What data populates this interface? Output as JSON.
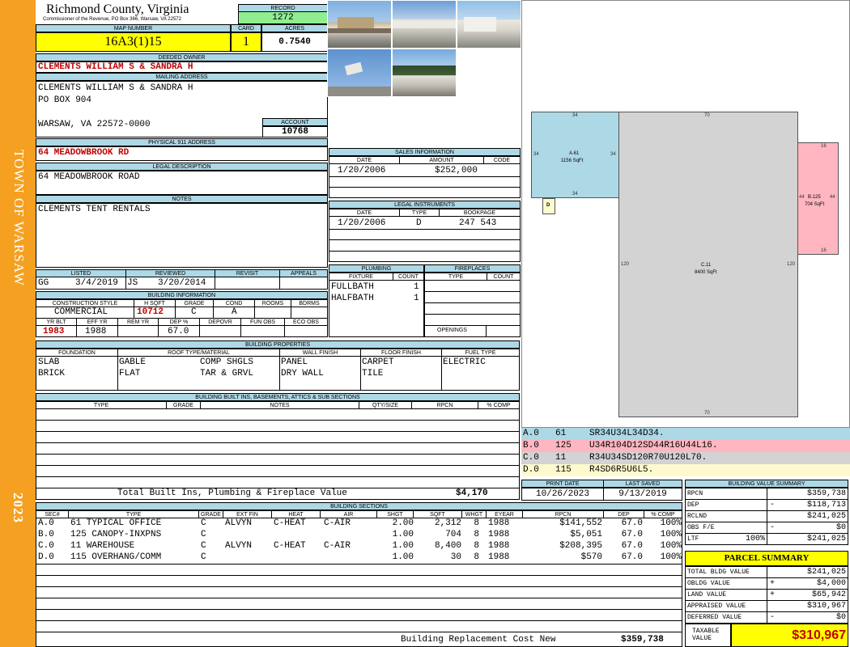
{
  "sidebar": {
    "town": "TOWN OF WARSAW",
    "year": "2023"
  },
  "header": {
    "county": "Richmond County, Virginia",
    "commissioner": "Commissioner of the Revenue, PO Box 366, Warsaw, VA 22572",
    "record_label": "RECORD",
    "record": "1272"
  },
  "parcel": {
    "map_label": "MAP NUMBER",
    "map_number": "16A3(1)15",
    "card_label": "CARD",
    "card": "1",
    "acres_label": "ACRES",
    "acres": "0.7540"
  },
  "owner": {
    "label": "DEEDED OWNER",
    "name": "CLEMENTS WILLIAM S & SANDRA H"
  },
  "mailing": {
    "label": "MAILING ADDRESS",
    "line1": "CLEMENTS WILLIAM S & SANDRA H",
    "line2": "PO BOX 904",
    "line3": "WARSAW, VA 22572-0000"
  },
  "account": {
    "label": "ACCOUNT",
    "value": "10768"
  },
  "physical": {
    "label": "PHYSICAL 911 ADDRESS",
    "value": "64 MEADOWBROOK RD"
  },
  "legal": {
    "label": "LEGAL DESCRIPTION",
    "value": "64 MEADOWBROOK ROAD"
  },
  "notes": {
    "label": "NOTES",
    "value": "CLEMENTS TENT RENTALS"
  },
  "sales": {
    "label": "SALES INFORMATION",
    "h_date": "DATE",
    "h_amount": "AMOUNT",
    "h_code": "CODE",
    "date": "1/20/2006",
    "amount": "$252,000"
  },
  "legal_inst": {
    "label": "LEGAL INSTRUMENTS",
    "h_date": "DATE",
    "h_type": "TYPE",
    "h_book": "BOOKPAGE",
    "date": "1/20/2006",
    "type": "D",
    "book": "247 543"
  },
  "plumbing": {
    "label": "PLUMBING",
    "h_fixture": "FIXTURE",
    "h_count": "COUNT",
    "rows": [
      {
        "fixture": "FULLBATH",
        "count": "1"
      },
      {
        "fixture": "HALFBATH",
        "count": "1"
      }
    ]
  },
  "fireplaces": {
    "label": "FIREPLACES",
    "h_type": "TYPE",
    "h_count": "COUNT",
    "openings": "OPENINGS"
  },
  "listing": {
    "h_listed": "LISTED",
    "h_reviewed": "REVIEWED",
    "h_revisit": "REVISIT",
    "h_appeals": "APPEALS",
    "listed_by": "GG",
    "listed_date": "3/4/2019",
    "reviewed_by": "JS",
    "reviewed_date": "3/20/2014"
  },
  "bldg_info": {
    "label": "BUILDING INFORMATION",
    "h_style": "CONSTRUCTION STYLE",
    "h_hsqft": "H SQFT",
    "h_grade": "GRADE",
    "h_cond": "COND",
    "h_rooms": "ROOMS",
    "h_bdrms": "BDRMS",
    "style": "COMMERCIAL",
    "hsqft": "10712",
    "grade": "C",
    "cond": "A",
    "h_yrblt": "YR BLT",
    "h_effyr": "EFF YR",
    "h_remyr": "REM YR",
    "h_dep": "DEP %",
    "h_depovr": "DEPOVR",
    "h_funobs": "FUN OBS",
    "h_ecoobs": "ECO OBS",
    "yrblt": "1983",
    "effyr": "1988",
    "dep": "67.0"
  },
  "props": {
    "label": "BUILDING PROPERTIES",
    "h_found": "FOUNDATION",
    "h_roof": "ROOF TYPE/MATERIAL",
    "h_wall": "WALL FINISH",
    "h_floor": "FLOOR FINISH",
    "h_fuel": "FUEL TYPE",
    "found1": "SLAB",
    "found2": "BRICK",
    "roof1a": "GABLE",
    "roof1b": "COMP SHGLS",
    "roof2a": "FLAT",
    "roof2b": "TAR & GRVL",
    "wall1": "PANEL",
    "wall2": "DRY WALL",
    "floor1": "CARPET",
    "floor2": "TILE",
    "fuel1": "ELECTRIC"
  },
  "builtins": {
    "label": "BUILDING BUILT INS, BASEMENTS, ATTICS & SUB SECTIONS",
    "h_type": "TYPE",
    "h_grade": "GRADE",
    "h_notes": "NOTES",
    "h_qty": "QTY/SIZE",
    "h_rpcn": "RPCN",
    "h_pct": "% COMP",
    "total_label": "Total Built Ins, Plumbing & Fireplace Value",
    "total": "$4,170"
  },
  "sketch_legend": [
    {
      "code": "A.0",
      "num": "61",
      "path": "SR34U34L34D34.",
      "color": "#add8e6"
    },
    {
      "code": "B.0",
      "num": "125",
      "path": "U34R104D12SD44R16U44L16.",
      "color": "#ffb6c1"
    },
    {
      "code": "C.0",
      "num": "11",
      "path": "R34U34SD120R70U120L70.",
      "color": "#d3d3d3"
    },
    {
      "code": "D.0",
      "num": "115",
      "path": "R4SD6R5U6L5.",
      "color": "#fffacd"
    }
  ],
  "sketch": {
    "a_label": "A.61",
    "a_area": "1156 SqFt",
    "a_top": "34",
    "a_left": "34",
    "a_right": "34",
    "a_bottom": "34",
    "b_label": "B.125",
    "b_area": "704 SqFt",
    "b_top": "16",
    "b_left": "44",
    "b_right": "44",
    "b_bottom": "16",
    "c_label": "C.11",
    "c_area": "8400 SqFt",
    "c_top": "70",
    "c_left": "120",
    "c_right": "120",
    "c_bottom": "70",
    "d_label": "D"
  },
  "dates": {
    "h_print": "PRINT DATE",
    "h_saved": "LAST SAVED",
    "print": "10/26/2023",
    "saved": "9/13/2019"
  },
  "sections": {
    "label": "BUILDING SECTIONS",
    "headers": [
      "SEC#",
      "TYPE",
      "GRADE",
      "EXT FIN",
      "HEAT",
      "AIR",
      "SHGT",
      "SQFT",
      "WHGT",
      "EYEAR",
      "RPCN",
      "DEP",
      "% COMP"
    ],
    "rows": [
      [
        "A.0",
        "61 TYPICAL OFFICE",
        "C",
        "ALVYN",
        "C-HEAT",
        "C-AIR",
        "2.00",
        "2,312",
        "8",
        "1988",
        "$141,552",
        "67.0",
        "100%"
      ],
      [
        "B.0",
        "125 CANOPY-INXPNS",
        "C",
        "",
        "",
        "",
        "1.00",
        "704",
        "8",
        "1988",
        "$5,051",
        "67.0",
        "100%"
      ],
      [
        "C.0",
        "11 WAREHOUSE",
        "C",
        "ALVYN",
        "C-HEAT",
        "C-AIR",
        "1.00",
        "8,400",
        "8",
        "1988",
        "$208,395",
        "67.0",
        "100%"
      ],
      [
        "D.0",
        "115 OVERHANG/COMM",
        "C",
        "",
        "",
        "",
        "1.00",
        "30",
        "8",
        "1988",
        "$570",
        "67.0",
        "100%"
      ]
    ],
    "replacement_label": "Building Replacement Cost New",
    "replacement": "$359,738"
  },
  "summary": {
    "label": "BUILDING VALUE SUMMARY",
    "rows": [
      {
        "k": "RPCN",
        "op": "",
        "pct": "",
        "v": "$359,738"
      },
      {
        "k": "DEP",
        "op": "-",
        "pct": "",
        "v": "$118,713"
      },
      {
        "k": "RCLND",
        "op": "",
        "pct": "",
        "v": "$241,025"
      },
      {
        "k": "OBS F/E",
        "op": "-",
        "pct": "",
        "v": "$0"
      },
      {
        "k": "LTF",
        "op": "",
        "pct": "100%",
        "v": "$241,025"
      }
    ]
  },
  "parcel_summary": {
    "label": "PARCEL SUMMARY",
    "rows": [
      {
        "k": "TOTAL BLDG VALUE",
        "op": "",
        "v": "$241,025"
      },
      {
        "k": "OBLDG VALUE",
        "op": "+",
        "v": "$4,000"
      },
      {
        "k": "LAND VALUE",
        "op": "+",
        "v": "$65,942"
      },
      {
        "k": "APPRAISED VALUE",
        "op": "",
        "v": "$310,967"
      },
      {
        "k": "DEFERRED VALUE",
        "op": "-",
        "v": "$0"
      }
    ],
    "taxable_label": "TAXABLE VALUE",
    "taxable": "$310,967"
  }
}
